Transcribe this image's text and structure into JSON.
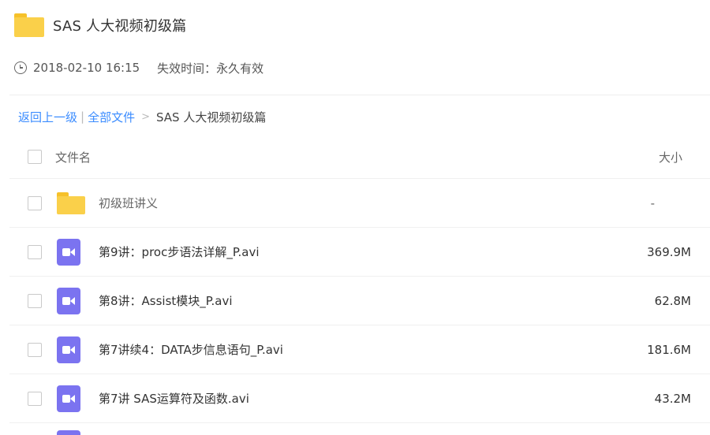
{
  "header": {
    "title": "SAS 人大视频初级篇"
  },
  "info": {
    "date": "2018-02-10 16:15",
    "expire": "失效时间：永久有效"
  },
  "breadcrumb": {
    "back": "返回上一级",
    "separator": "|",
    "all_files": "全部文件",
    "arrow": ">",
    "current": "SAS 人大视频初级篇"
  },
  "table": {
    "col_name": "文件名",
    "col_size": "大小",
    "rows": [
      {
        "name": "初级班讲义",
        "size": "-",
        "type": "folder"
      },
      {
        "name": "第9讲：proc步语法详解_P.avi",
        "size": "369.9M",
        "type": "video"
      },
      {
        "name": "第8讲：Assist模块_P.avi",
        "size": "62.8M",
        "type": "video"
      },
      {
        "name": "第7讲续4：DATA步信息语句_P.avi",
        "size": "181.6M",
        "type": "video"
      },
      {
        "name": "第7讲 SAS运算符及函数.avi",
        "size": "43.2M",
        "type": "video"
      }
    ]
  },
  "colors": {
    "link": "#3b8cff",
    "folder": "#fad04a",
    "video": "#7b73f0"
  },
  "icons": {
    "folder": "folder-icon",
    "video": "video-file-icon",
    "clock": "clock-icon",
    "checkbox": "checkbox-icon"
  }
}
